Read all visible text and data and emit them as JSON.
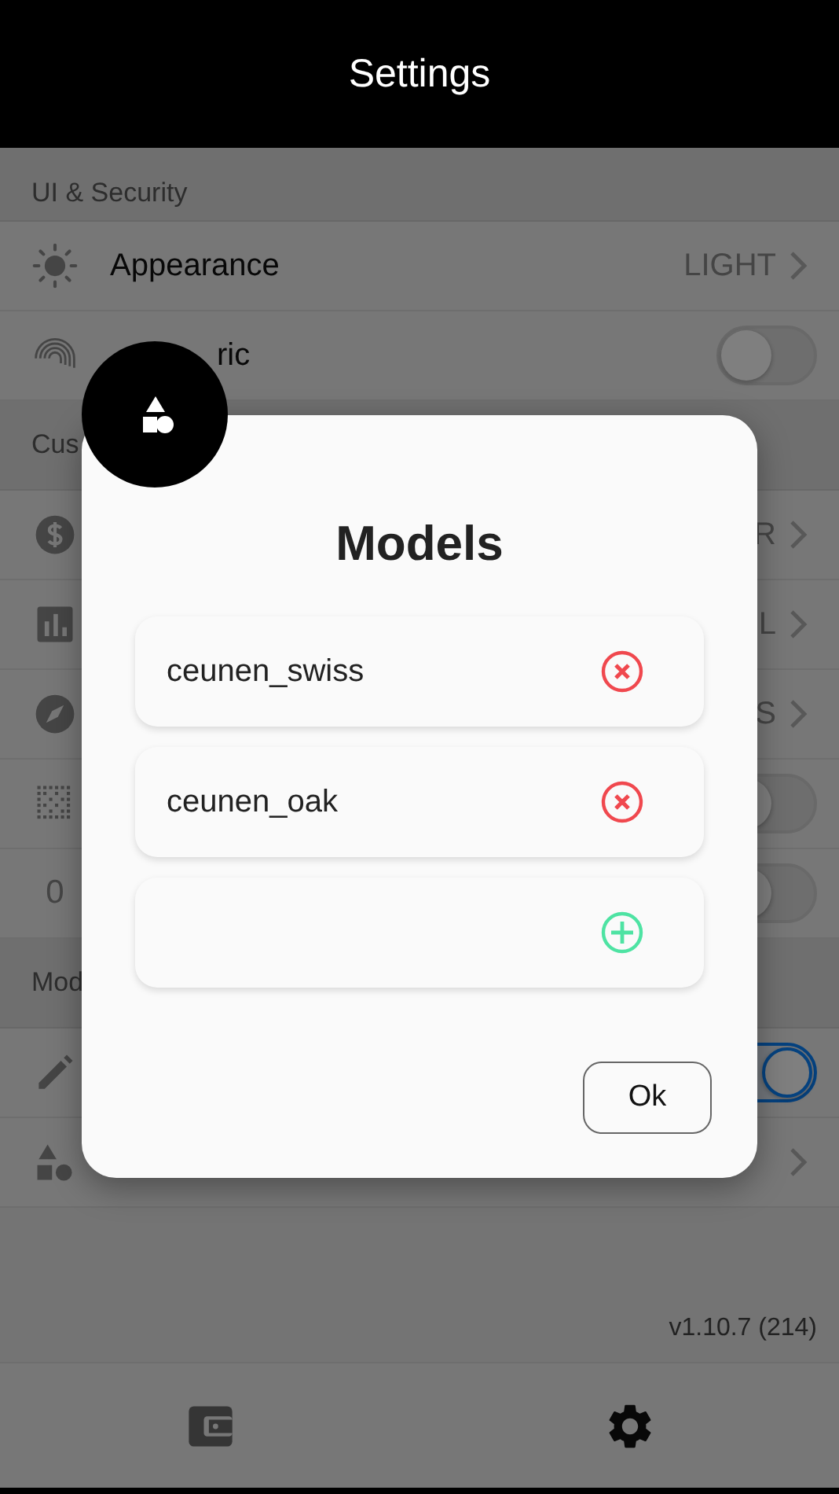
{
  "header": {
    "title": "Settings"
  },
  "sections": [
    {
      "header": "UI & Security",
      "rows": [
        {
          "kind": "link",
          "label": "Appearance",
          "value": "LIGHT"
        },
        {
          "kind": "toggle",
          "label": "ric",
          "on": false
        }
      ]
    },
    {
      "header": "Cus",
      "rows": [
        {
          "kind": "link",
          "value": "R"
        },
        {
          "kind": "link",
          "value": "L"
        },
        {
          "kind": "link",
          "value": "S"
        },
        {
          "kind": "toggle",
          "on": false
        },
        {
          "kind": "toggle",
          "lead": "0",
          "on": false
        }
      ]
    },
    {
      "header": "Mod",
      "rows": [
        {
          "kind": "toggle",
          "on": true
        },
        {
          "kind": "link"
        }
      ]
    }
  ],
  "version": "v1.10.7 (214)",
  "tabs": [
    {
      "selected": false
    },
    {
      "selected": true
    }
  ],
  "dialog": {
    "title": "Models",
    "items": [
      {
        "kind": "model",
        "name": "ceunen_swiss"
      },
      {
        "kind": "model",
        "name": "ceunen_oak"
      },
      {
        "kind": "new"
      }
    ],
    "button": "Ok"
  }
}
